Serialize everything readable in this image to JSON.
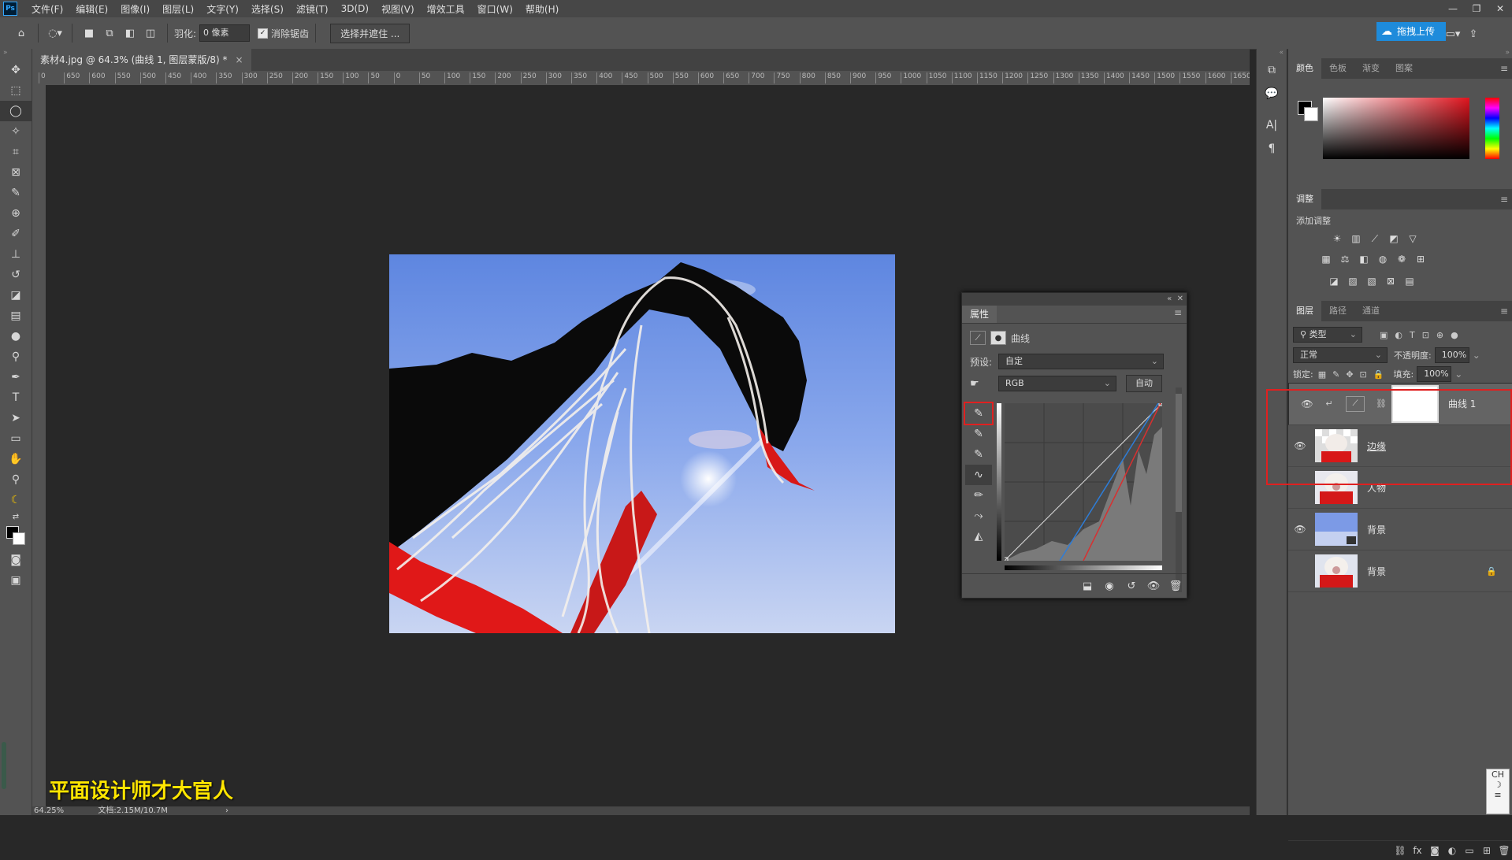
{
  "app": {
    "logo": "Ps"
  },
  "menu": [
    "文件(F)",
    "编辑(E)",
    "图像(I)",
    "图层(L)",
    "文字(Y)",
    "选择(S)",
    "滤镜(T)",
    "3D(D)",
    "视图(V)",
    "增效工具",
    "窗口(W)",
    "帮助(H)"
  ],
  "options": {
    "feather_label": "羽化:",
    "feather_value": "0 像素",
    "antialias_label": "消除锯齿",
    "select_mask_button": "选择并遮住 ..."
  },
  "upload_button": "拖拽上传",
  "document": {
    "tab_title": "素材4.jpg @ 64.3% (曲线 1, 图层蒙版/8) *",
    "zoom": "64.25%",
    "doc_info": "文档:2.15M/10.7M"
  },
  "ruler_ticks": [
    "0",
    "650",
    "600",
    "550",
    "500",
    "450",
    "400",
    "350",
    "300",
    "250",
    "200",
    "150",
    "100",
    "50",
    "0",
    "50",
    "100",
    "150",
    "200",
    "250",
    "300",
    "350",
    "400",
    "450",
    "500",
    "550",
    "600",
    "650",
    "700",
    "750",
    "800",
    "850",
    "900",
    "950",
    "1000",
    "1050",
    "1100",
    "1150",
    "1200",
    "1250",
    "1300",
    "1350",
    "1400",
    "1450",
    "1500",
    "1550",
    "1600",
    "1650"
  ],
  "watermark": "平面设计师才大官人",
  "properties": {
    "tab": "属性",
    "type_label": "曲线",
    "preset_label": "预设:",
    "preset_value": "自定",
    "channel_value": "RGB",
    "auto_button": "自动"
  },
  "color_panel": {
    "tabs": [
      "颜色",
      "色板",
      "渐变",
      "图案"
    ],
    "fg": "#000000",
    "bg": "#ffffff"
  },
  "adjust_panel": {
    "tab": "调整",
    "add_label": "添加调整"
  },
  "layers_panel": {
    "tabs": [
      "图层",
      "路径",
      "通道"
    ],
    "filter_value": "类型",
    "blend_mode": "正常",
    "opacity_label": "不透明度:",
    "opacity_value": "100%",
    "lock_label": "锁定:",
    "fill_label": "填充:",
    "fill_value": "100%",
    "layers": [
      {
        "name": "曲线 1",
        "visible": true
      },
      {
        "name": "边缘",
        "visible": true
      },
      {
        "name": "人物",
        "visible": false
      },
      {
        "name": "背景",
        "visible": true
      },
      {
        "name": "背景",
        "visible": false
      }
    ]
  },
  "ime": {
    "label": "CH"
  }
}
